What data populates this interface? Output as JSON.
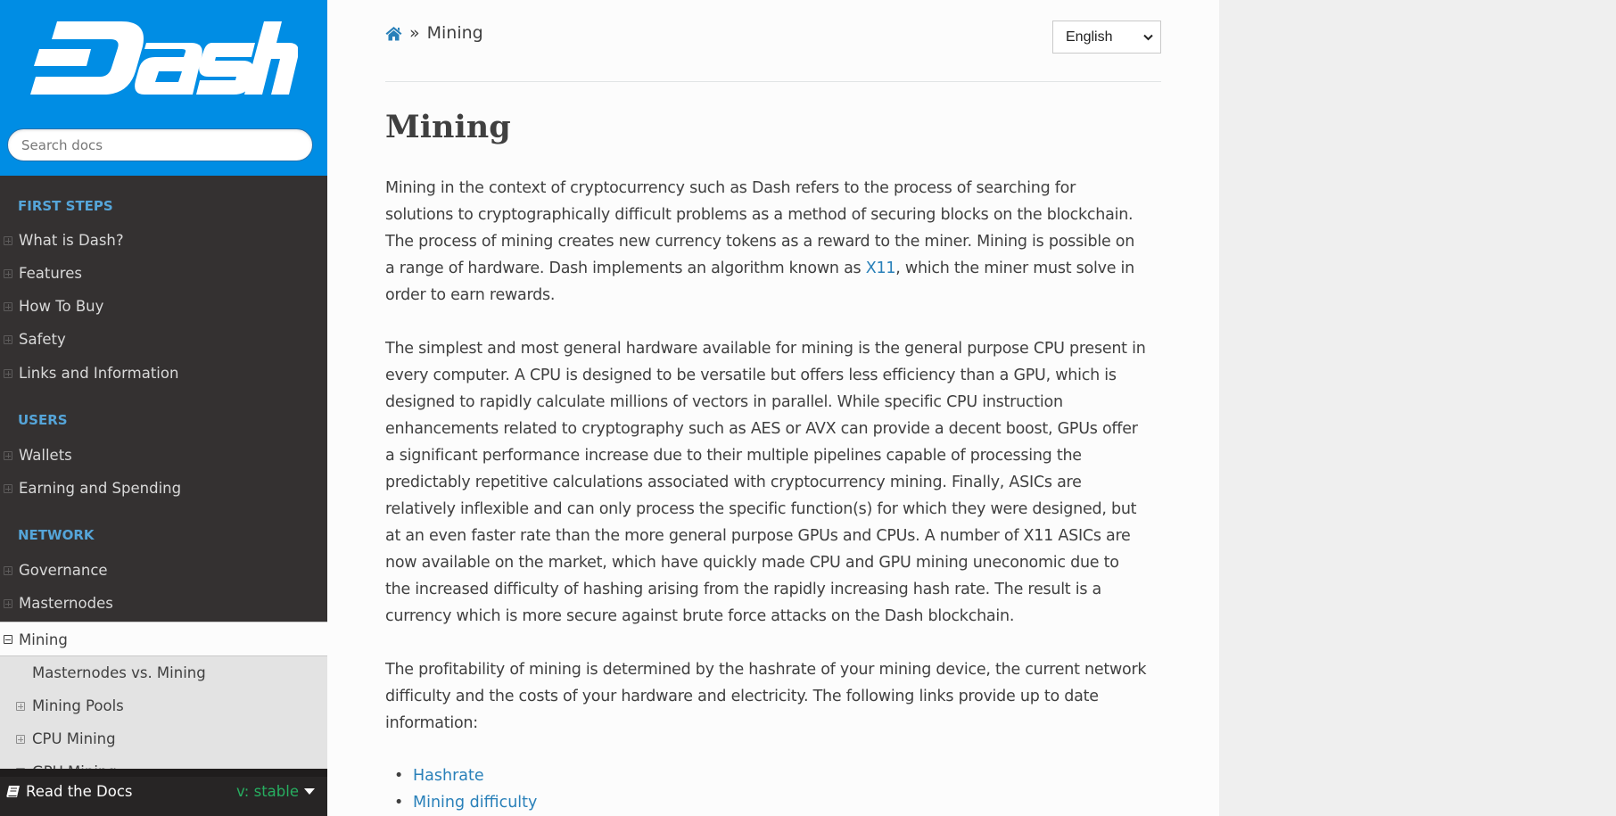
{
  "sidebar": {
    "logo_text": "Dash",
    "search_placeholder": "Search docs",
    "sections": [
      {
        "caption": "FIRST STEPS",
        "items": [
          "What is Dash?",
          "Features",
          "How To Buy",
          "Safety",
          "Links and Information"
        ]
      },
      {
        "caption": "USERS",
        "items": [
          "Wallets",
          "Earning and Spending"
        ]
      },
      {
        "caption": "NETWORK",
        "items": [
          "Governance",
          "Masternodes"
        ]
      }
    ],
    "current": "Mining",
    "sub_items": [
      "Masternodes vs. Mining",
      "Mining Pools",
      "CPU Mining",
      "GPU Mining"
    ],
    "footer": {
      "label": "Read the Docs",
      "version": "v: stable"
    }
  },
  "header": {
    "breadcrumb_sep": "»",
    "breadcrumb_current": "Mining",
    "language": "English"
  },
  "main": {
    "title": "Mining",
    "p1": {
      "lines": [
        "Mining in the context of cryptocurrency such as Dash refers to the process of searching for",
        "solutions to cryptographically difficult problems as a method of securing blocks on the blockchain.",
        "The process of mining creates new currency tokens as a reward to the miner. Mining is possible on"
      ],
      "line4_before": "a range of hardware. Dash implements an algorithm known as ",
      "link": "X11",
      "line4_after": ", which the miner must solve in",
      "line5": "order to earn rewards."
    },
    "p2": {
      "lines": [
        "The simplest and most general hardware available for mining is the general purpose CPU present in",
        "every computer. A CPU is designed to be versatile but offers less efficiency than a GPU, which is",
        "designed to rapidly calculate millions of vectors in parallel. While specific CPU instruction",
        "enhancements related to cryptography such as AES or AVX can provide a decent boost, GPUs offer",
        "a significant performance increase due to their multiple pipelines capable of processing the",
        "predictably repetitive calculations associated with cryptocurrency mining. Finally, ASICs are",
        "relatively inflexible and can only process the specific function(s) for which they were designed, but",
        "at an even faster rate than the more general purpose GPUs and CPUs. A number of X11 ASICs are",
        "now available on the market, which have quickly made CPU and GPU mining uneconomic due to",
        "the increased difficulty of hashing arising from the rapidly increasing hash rate. The result is a",
        "currency which is more secure against brute force attacks on the Dash blockchain."
      ]
    },
    "p3": {
      "lines": [
        "The profitability of mining is determined by the hashrate of your mining device, the current network",
        "difficulty and the costs of your hardware and electricity. The following links provide up to date",
        "information:"
      ]
    },
    "links": [
      "Hashrate",
      "Mining difficulty"
    ]
  },
  "colors": {
    "brand": "#008de4",
    "sidebar_bg": "#343131",
    "caption": "#55a5d9",
    "link": "#2980b9",
    "version": "#27ae60"
  }
}
